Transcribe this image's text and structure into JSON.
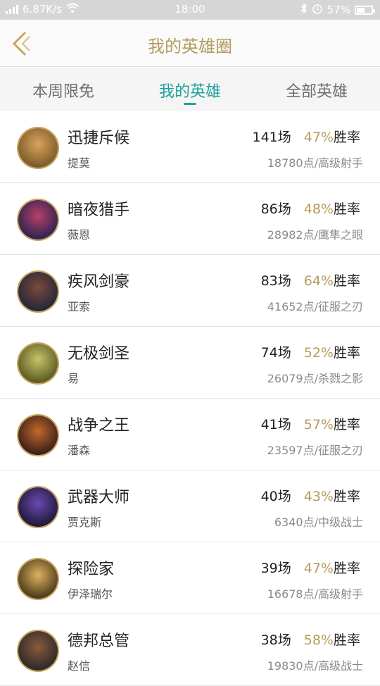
{
  "status_bar": {
    "net_speed": "6.87K/s",
    "time": "18:00",
    "battery": "57%",
    "battery_level": 0.57
  },
  "header": {
    "title": "我的英雄圈"
  },
  "tabs": [
    {
      "label": "本周限免",
      "active": false
    },
    {
      "label": "我的英雄",
      "active": true
    },
    {
      "label": "全部英雄",
      "active": false
    }
  ],
  "colors": {
    "accent": "#1fa39a",
    "gold": "#b49a5e",
    "rate": "#b89a5a"
  },
  "heroes": [
    {
      "name": "迅捷斥候",
      "title": "提莫",
      "games": "141场",
      "rate": "47%",
      "rate_suffix": "胜率",
      "points": "18780点/高级射手"
    },
    {
      "name": "暗夜猎手",
      "title": "薇恩",
      "games": "86场",
      "rate": "48%",
      "rate_suffix": "胜率",
      "points": "28982点/鹰隼之眼"
    },
    {
      "name": "疾风剑豪",
      "title": "亚索",
      "games": "83场",
      "rate": "64%",
      "rate_suffix": "胜率",
      "points": "41652点/征服之刃"
    },
    {
      "name": "无极剑圣",
      "title": "易",
      "games": "74场",
      "rate": "52%",
      "rate_suffix": "胜率",
      "points": "26079点/杀戮之影"
    },
    {
      "name": "战争之王",
      "title": "潘森",
      "games": "41场",
      "rate": "57%",
      "rate_suffix": "胜率",
      "points": "23597点/征服之刃"
    },
    {
      "name": "武器大师",
      "title": "贾克斯",
      "games": "40场",
      "rate": "43%",
      "rate_suffix": "胜率",
      "points": "6340点/中级战士"
    },
    {
      "name": "探险家",
      "title": "伊泽瑞尔",
      "games": "39场",
      "rate": "47%",
      "rate_suffix": "胜率",
      "points": "16678点/高级射手"
    },
    {
      "name": "德邦总管",
      "title": "赵信",
      "games": "38场",
      "rate": "58%",
      "rate_suffix": "胜率",
      "points": "19830点/高级战士"
    }
  ]
}
